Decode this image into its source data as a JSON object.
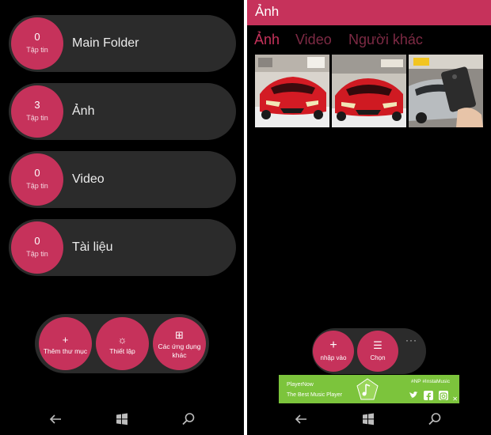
{
  "left_screen": {
    "folders": [
      {
        "count": "0",
        "unit": "Tập tin",
        "name": "Main Folder"
      },
      {
        "count": "3",
        "unit": "Tập tin",
        "name": "Ảnh"
      },
      {
        "count": "0",
        "unit": "Tập tin",
        "name": "Video"
      },
      {
        "count": "0",
        "unit": "Tập tin",
        "name": "Tài liệu"
      }
    ],
    "actions": [
      {
        "glyph": "+",
        "label": "Thêm thư mục"
      },
      {
        "glyph": "☼",
        "label": "Thiết lập"
      },
      {
        "glyph": "⊞",
        "label": "Các ứng dụng khác"
      }
    ]
  },
  "right_screen": {
    "title": "Ảnh",
    "tabs": [
      "Ảnh",
      "Video",
      "Người khác"
    ],
    "actions": [
      {
        "glyph": "+",
        "label": "nhập vào"
      },
      {
        "glyph": "☰",
        "label": "Chọn"
      }
    ],
    "more": "···",
    "ad": {
      "name": "PlayerNow",
      "tagline": "The Best Music Player",
      "hashtags": "#NP #InstaMusic",
      "close": "✕"
    }
  },
  "colors": {
    "accent": "#c6325b",
    "pill": "#2b2b2b",
    "background": "#000000",
    "tab_inactive": "#7d2a44",
    "ad_green": "#7cc43c"
  },
  "icons": {
    "nav": [
      "back-arrow-icon",
      "windows-start-icon",
      "search-icon"
    ],
    "ad": [
      "music-note-icon",
      "twitter-icon",
      "facebook-icon",
      "instagram-icon"
    ]
  }
}
